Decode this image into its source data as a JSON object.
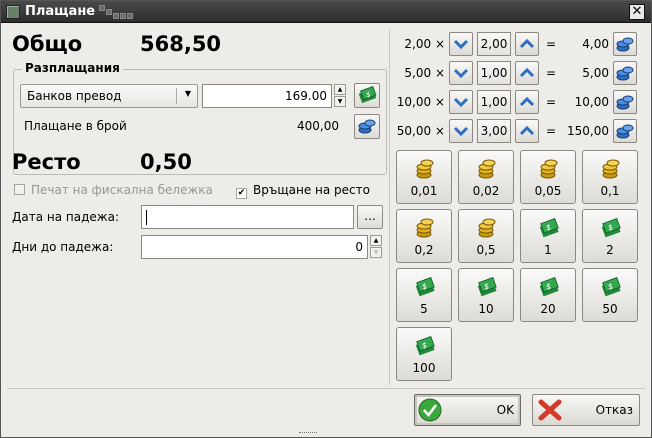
{
  "window": {
    "title": "Плащане"
  },
  "totals": {
    "total_label": "Общо",
    "total_value": "568,50",
    "change_label": "Ресто",
    "change_value": "0,50"
  },
  "payments": {
    "group_title": "Разплащания",
    "method_selected": "Банков превод",
    "amount_value": "169.00",
    "cash_label": "Плащане в брой",
    "cash_value": "400,00"
  },
  "options": {
    "print_receipt_label": "Печат на фискална бележка",
    "print_receipt_checked": false,
    "return_change_label": "Връщане на ресто",
    "return_change_checked": true
  },
  "due": {
    "date_label": "Дата на падежа:",
    "date_value": "",
    "date_button": "...",
    "days_label": "Дни до падежа:",
    "days_value": "0"
  },
  "multipliers": [
    {
      "label": "2,00 ×",
      "qty": "2,00",
      "eq": "=",
      "result": "4,00"
    },
    {
      "label": "5,00 ×",
      "qty": "1,00",
      "eq": "=",
      "result": "5,00"
    },
    {
      "label": "10,00 ×",
      "qty": "1,00",
      "eq": "=",
      "result": "10,00"
    },
    {
      "label": "50,00 ×",
      "qty": "3,00",
      "eq": "=",
      "result": "150,00"
    }
  ],
  "denominations": [
    {
      "label": "0,01",
      "icon": "coins-icon"
    },
    {
      "label": "0,02",
      "icon": "coins-icon"
    },
    {
      "label": "0,05",
      "icon": "coins-icon"
    },
    {
      "label": "0,1",
      "icon": "coins-icon"
    },
    {
      "label": "0,2",
      "icon": "coins-icon"
    },
    {
      "label": "0,5",
      "icon": "coins-icon"
    },
    {
      "label": "1",
      "icon": "banknote-icon"
    },
    {
      "label": "2",
      "icon": "banknote-icon"
    },
    {
      "label": "5",
      "icon": "banknote-icon"
    },
    {
      "label": "10",
      "icon": "banknote-icon"
    },
    {
      "label": "20",
      "icon": "banknote-icon"
    },
    {
      "label": "50",
      "icon": "banknote-icon"
    },
    {
      "label": "100",
      "icon": "banknote-icon"
    }
  ],
  "buttons": {
    "ok_label": "OK",
    "cancel_label": "Отказ"
  },
  "colors": {
    "accent_blue": "#2f6fc0",
    "money_green": "#1f8a3a",
    "coin_gold": "#e0b020",
    "cancel_red": "#d23a2a",
    "ok_green": "#3aa83a"
  }
}
